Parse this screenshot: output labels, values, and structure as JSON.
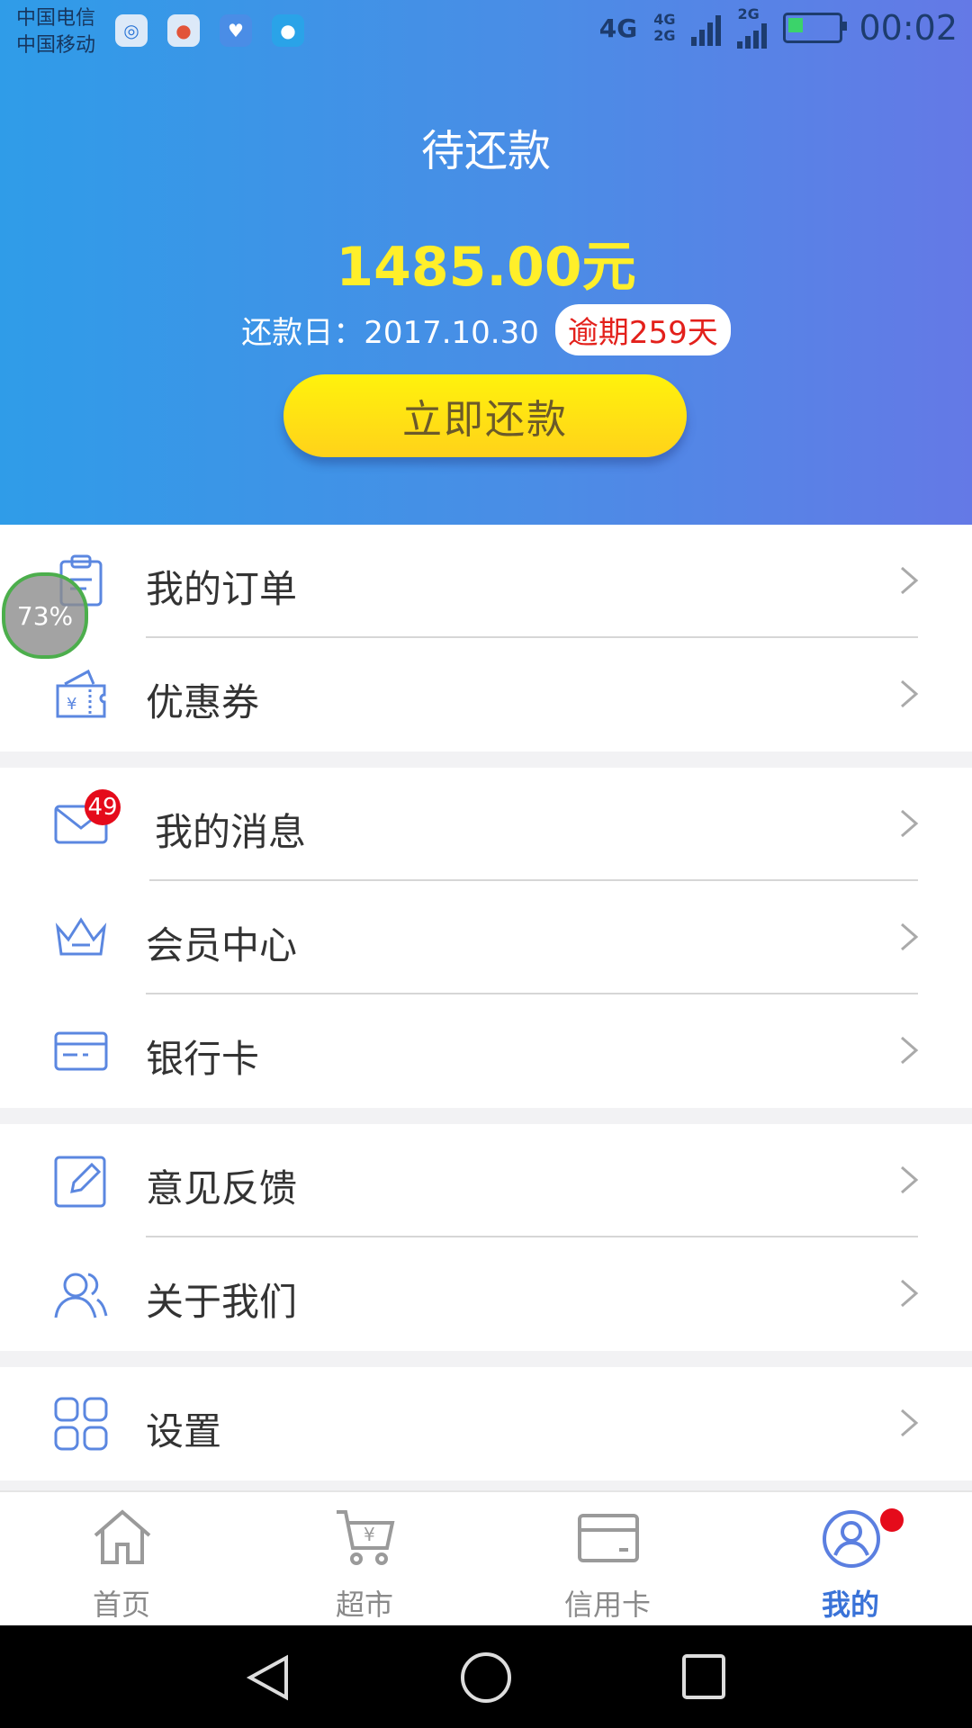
{
  "status": {
    "carrier1": "中国电信",
    "carrier2": "中国移动",
    "network1": "4G",
    "network2": "4G",
    "network3": "2G",
    "network4": "2G",
    "time": "00:02"
  },
  "repayment": {
    "title": "待还款",
    "amount": "1485.00元",
    "due_date": "还款日：2017.10.30",
    "overdue": "逾期259天",
    "pay_button": "立即还款"
  },
  "floating_ball": "73%",
  "menu_groups": [
    [
      {
        "label": "我的订单",
        "icon": "clipboard-icon"
      },
      {
        "label": "优惠券",
        "icon": "coupon-icon"
      }
    ],
    [
      {
        "label": "我的消息",
        "icon": "envelope-icon",
        "badge": "49"
      },
      {
        "label": "会员中心",
        "icon": "crown-icon"
      },
      {
        "label": "银行卡",
        "icon": "bank-card-icon"
      }
    ],
    [
      {
        "label": "意见反馈",
        "icon": "edit-icon"
      },
      {
        "label": "关于我们",
        "icon": "people-icon"
      }
    ],
    [
      {
        "label": "设置",
        "icon": "grid-icon"
      }
    ]
  ],
  "tabs": [
    {
      "label": "首页",
      "icon": "home-icon"
    },
    {
      "label": "超市",
      "icon": "cart-icon"
    },
    {
      "label": "信用卡",
      "icon": "credit-card-icon"
    },
    {
      "label": "我的",
      "icon": "user-icon",
      "active": true
    }
  ],
  "colors": {
    "accent": "#3a73d8",
    "amount": "#ffef2a",
    "overdue": "#e3201b",
    "icon": "#5b87e0"
  }
}
